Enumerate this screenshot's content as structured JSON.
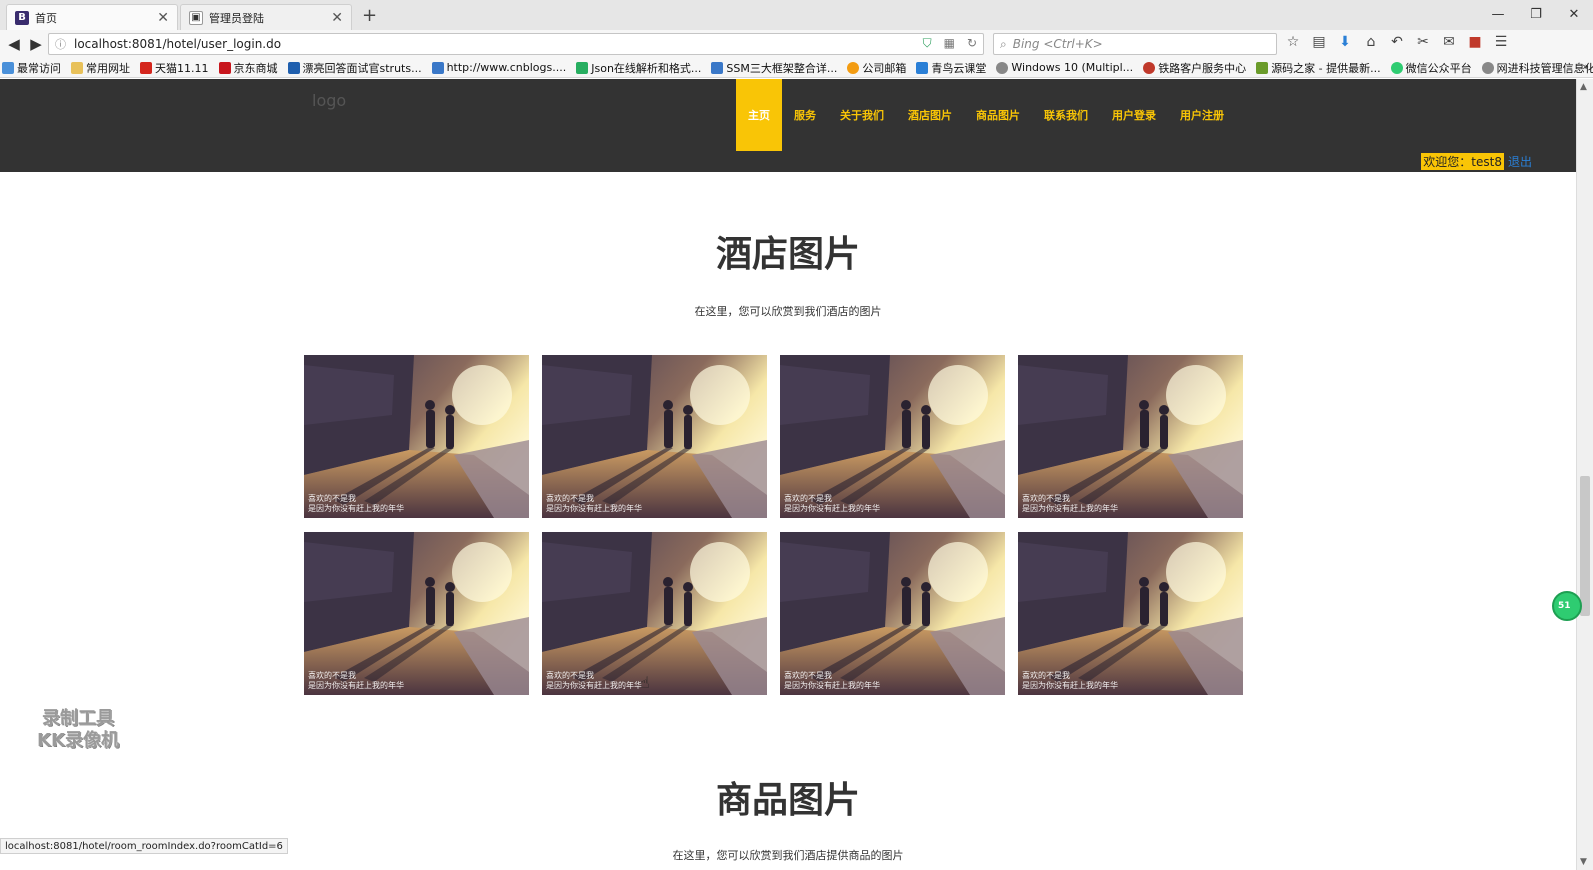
{
  "browser": {
    "tabs": [
      {
        "favicon": "B",
        "title": "首页",
        "active": true
      },
      {
        "favicon": "▣",
        "title": "管理员登陆",
        "active": false
      }
    ],
    "new_tab": "+",
    "address": "localhost:8081/hotel/user_login.do",
    "search_placeholder": "Bing <Ctrl+K>",
    "window_controls": {
      "minimize": "—",
      "restore": "❐",
      "close": "✕"
    },
    "bookmarks": [
      "最常访问",
      "常用网址",
      "天猫11.11",
      "京东商城",
      "漂亮回答面试官struts...",
      "http://www.cnblogs....",
      "Json在线解析和格式...",
      "SSM三大框架整合详...",
      "公司邮箱",
      "青鸟云课堂",
      "Windows 10 (Multipl...",
      "铁路客户服务中心",
      "源码之家 - 提供最新...",
      "微信公众平台",
      "网进科技管理信息化..."
    ],
    "bookmarks_more": "»",
    "status_url": "localhost:8081/hotel/room_roomIndex.do?roomCatId=6"
  },
  "site": {
    "logo": "logo",
    "menu": [
      "主页",
      "服务",
      "关于我们",
      "酒店图片",
      "商品图片",
      "联系我们",
      "用户登录",
      "用户注册"
    ],
    "welcome": "欢迎您：test8",
    "logout": "退出"
  },
  "hotel_section": {
    "title": "酒店图片",
    "subtitle": "在这里，您可以欣赏到我们酒店的图片",
    "photos": 8,
    "photo_caption_1": "喜欢的不是我",
    "photo_caption_2": "是因为你没有赶上我的年华"
  },
  "goods_section": {
    "title": "商品图片",
    "subtitle": "在这里，您可以欣赏到我们酒店提供商品的图片"
  },
  "overlay": {
    "watermark_1": "录制工具",
    "watermark_2": "KK录像机",
    "widget": "51"
  },
  "colors": {
    "accent": "#f9c506",
    "header_bg": "#333333",
    "link": "#2a7fd6"
  }
}
